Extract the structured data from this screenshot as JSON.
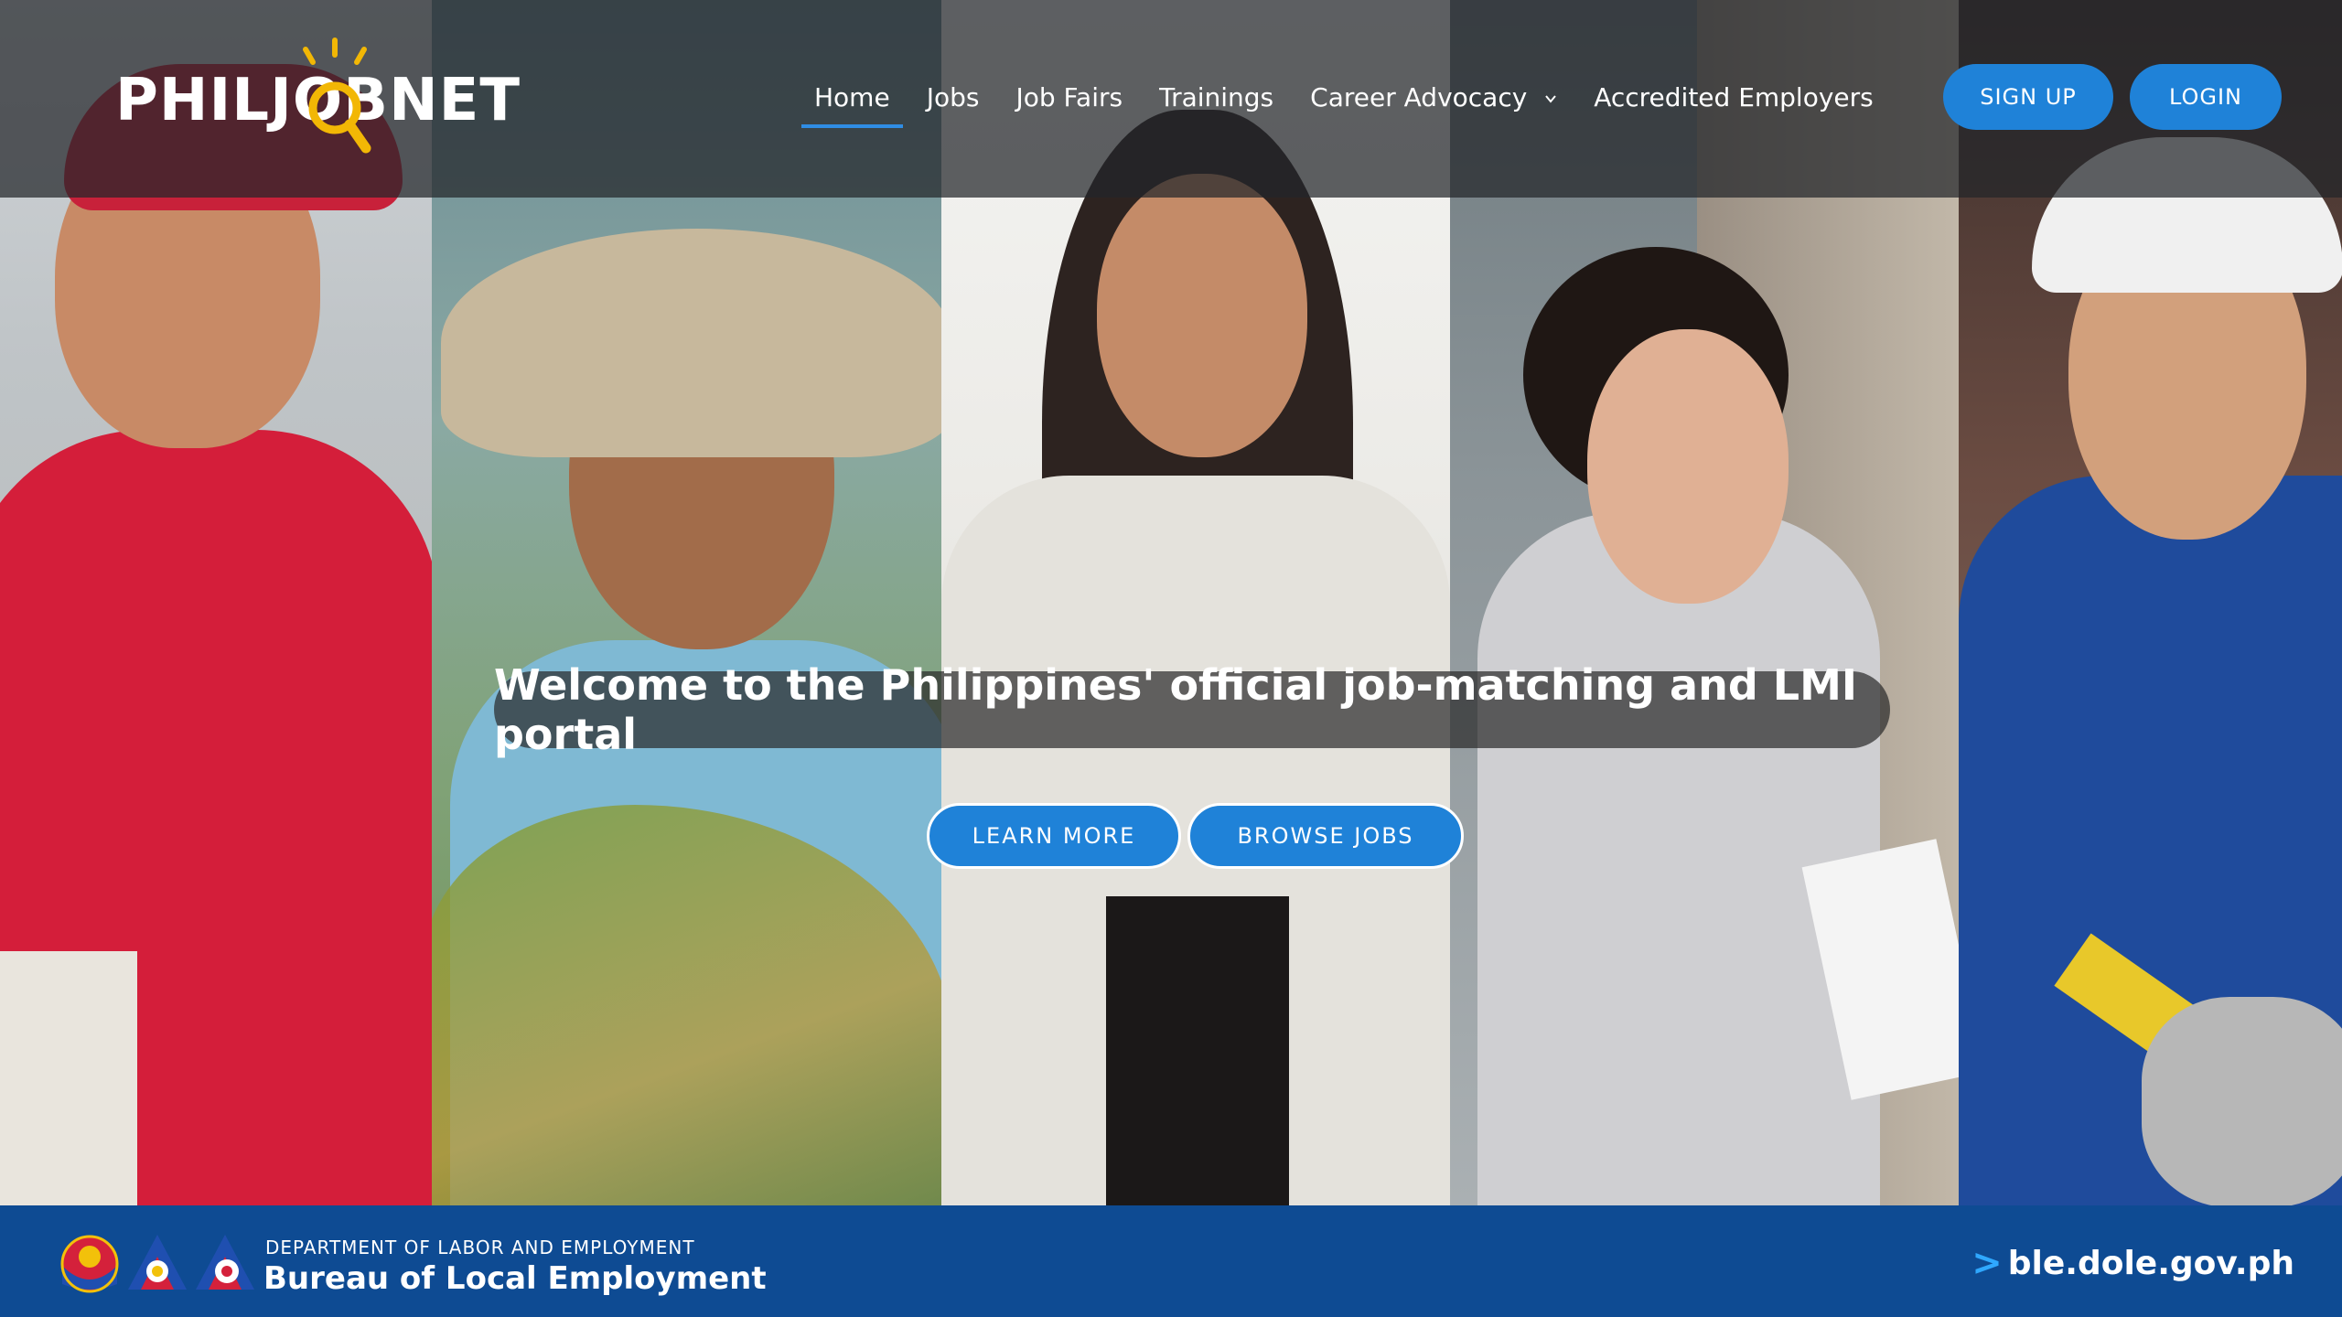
{
  "logo": {
    "brand": "PHILJOBNET",
    "icon": "magnifier-sun-logo"
  },
  "nav": {
    "items": [
      {
        "label": "Home",
        "active": true
      },
      {
        "label": "Jobs"
      },
      {
        "label": "Job Fairs"
      },
      {
        "label": "Trainings"
      },
      {
        "label": "Career Advocacy",
        "has_dropdown": true,
        "icon": "chevron-down-icon"
      },
      {
        "label": "Accredited Employers"
      }
    ],
    "signup_label": "SIGN UP",
    "login_label": "LOGIN"
  },
  "hero": {
    "welcome": "Welcome to the Philippines' official job-matching and LMI portal",
    "learn_more_label": "LEARN MORE",
    "browse_jobs_label": "BROWSE JOBS"
  },
  "footer": {
    "department": "DEPARTMENT OF LABOR AND EMPLOYMENT",
    "bureau": "Bureau of Local Employment",
    "url": "ble.dole.gov.ph",
    "url_prefix": ">",
    "seals": [
      "philippine-seal-icon",
      "dole-seal-icon",
      "ble-seal-icon"
    ]
  },
  "colors": {
    "primary_button": "#1f82d8",
    "footer_bg": "#0e4b93",
    "active_underline": "#2f8de4",
    "url_arrow": "#2fa8ff"
  }
}
